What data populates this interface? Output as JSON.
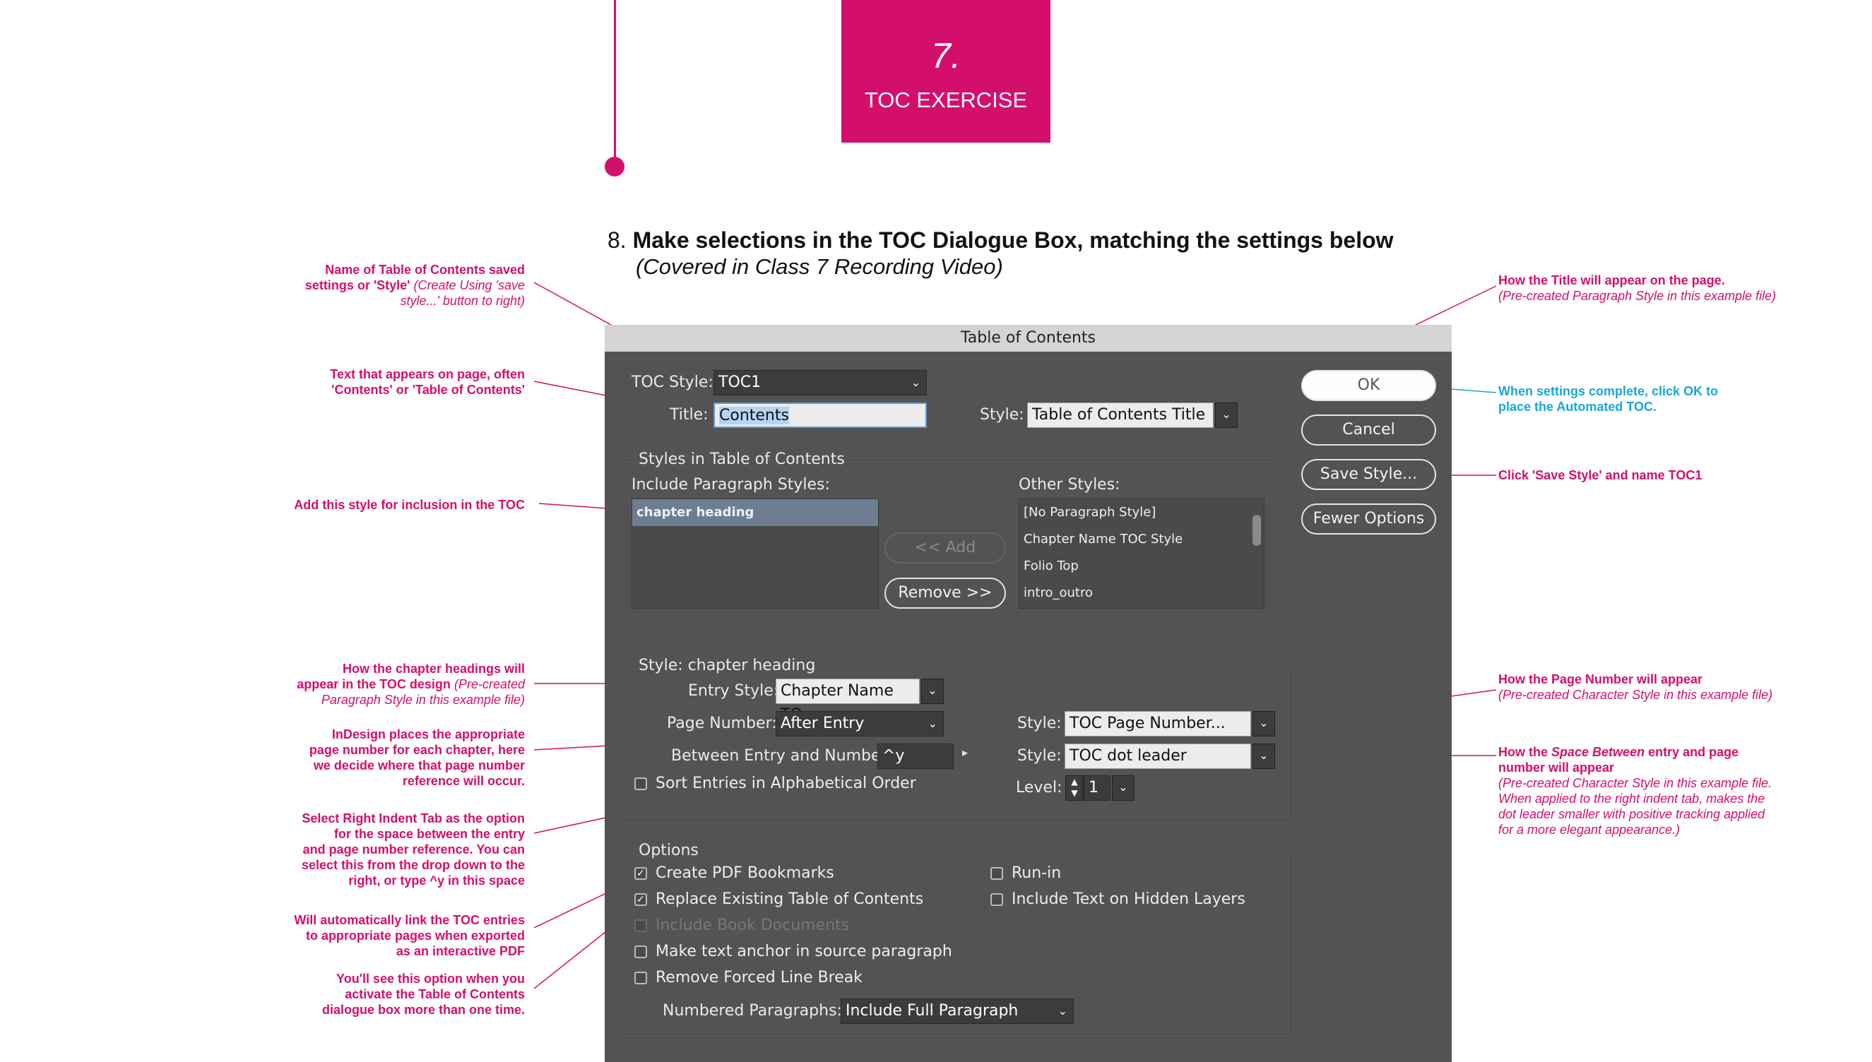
{
  "header": {
    "number": "7.",
    "label": "TOC EXERCISE"
  },
  "step": {
    "number": "8.",
    "title": "Make selections in the TOC Dialogue Box, matching the settings below",
    "subtitle": "(Covered in Class 7 Recording Video)"
  },
  "annotations": {
    "toc_style_a": "Name of Table of Contents saved",
    "toc_style_b": "settings or 'Style'",
    "toc_style_c": "(Create Using 'save",
    "toc_style_d": "style...' button to right)",
    "title_a": "Text that appears on page, often",
    "title_b": "'Contents' or 'Table of Contents'",
    "include": "Add this style for inclusion in the TOC",
    "entry_a": "How the chapter headings will",
    "entry_b": "appear in the TOC design",
    "entry_c": "(Pre-created",
    "entry_d": "Paragraph Style in this example file)",
    "page_a": "InDesign places the appropriate",
    "page_b": "page number for each chapter, here",
    "page_c": "we decide where that page number",
    "page_d": "reference will occur.",
    "between_a": "Select Right Indent Tab as the option",
    "between_b": "for  the space between the entry",
    "between_c": "and page number reference. You can",
    "between_d": "select this from the drop down to the",
    "between_e": "right, or type ^y in this space",
    "bookmarks_a": "Will automatically link the TOC entries",
    "bookmarks_b": "to appropriate pages when exported",
    "bookmarks_c": "as an interactive PDF",
    "replace_a": "You'll see this option when you",
    "replace_b": "activate the Table of Contents",
    "replace_c": "dialogue box more than one time.",
    "title_style_a": "How the Title will appear on the page.",
    "title_style_b": "(Pre-created Paragraph Style in this example file)",
    "ok_a": "When settings complete, click OK to",
    "ok_b": "place the Automated TOC.",
    "save": "Click 'Save Style' and name TOC1",
    "pagenum_a": "How the Page Number will appear",
    "pagenum_b": "(Pre-created Character Style in this example file)",
    "space_a": "How the",
    "space_b": "Space Between",
    "space_c": "entry and page",
    "space_d": "number will appear",
    "space_e": "(Pre-created Character Style in this example file.",
    "space_f": "When applied to the right indent tab, makes the",
    "space_g": "dot leader smaller with positive tracking applied",
    "space_h": "for a more elegant appearance.)"
  },
  "dialog": {
    "title": "Table of Contents",
    "toc_style_label": "TOC Style:",
    "toc_style_value": "TOC1",
    "title_label": "Title:",
    "title_value": "Contents",
    "style_label": "Style:",
    "title_style_value": "Table of Contents Title",
    "buttons": {
      "ok": "OK",
      "cancel": "Cancel",
      "save": "Save Style...",
      "fewer": "Fewer Options"
    },
    "styles_group_label": "Styles in Table of Contents",
    "include_label": "Include Paragraph Styles:",
    "include_items": [
      "chapter heading"
    ],
    "other_label": "Other Styles:",
    "other_items": [
      "[No Paragraph Style]",
      "Chapter Name TOC Style",
      "Folio Top",
      "intro_outro"
    ],
    "add_button": "<< Add",
    "remove_button": "Remove >>",
    "style_group_label": "Style: chapter heading",
    "entry_style_label": "Entry Style:",
    "entry_style_value": "Chapter Name TO...",
    "page_number_label": "Page Number:",
    "page_number_value": "After Entry",
    "page_style_value": "TOC Page Number...",
    "between_label": "Between Entry and Number:",
    "between_value": "^y",
    "between_style_value": "TOC dot leader",
    "sort_label": "Sort Entries in Alphabetical Order",
    "level_label": "Level:",
    "level_value": "1",
    "options_label": "Options",
    "opt_bookmarks": "Create PDF Bookmarks",
    "opt_replace": "Replace Existing Table of Contents",
    "opt_book": "Include Book Documents",
    "opt_anchor": "Make text anchor in source paragraph",
    "opt_linebreak": "Remove Forced Line Break",
    "opt_runin": "Run-in",
    "opt_hidden": "Include Text on Hidden Layers",
    "numbered_label": "Numbered Paragraphs:",
    "numbered_value": "Include Full Paragraph"
  },
  "colors": {
    "accent": "#d40f6b",
    "info": "#1aa6d6",
    "dialog_bg": "#535353"
  }
}
